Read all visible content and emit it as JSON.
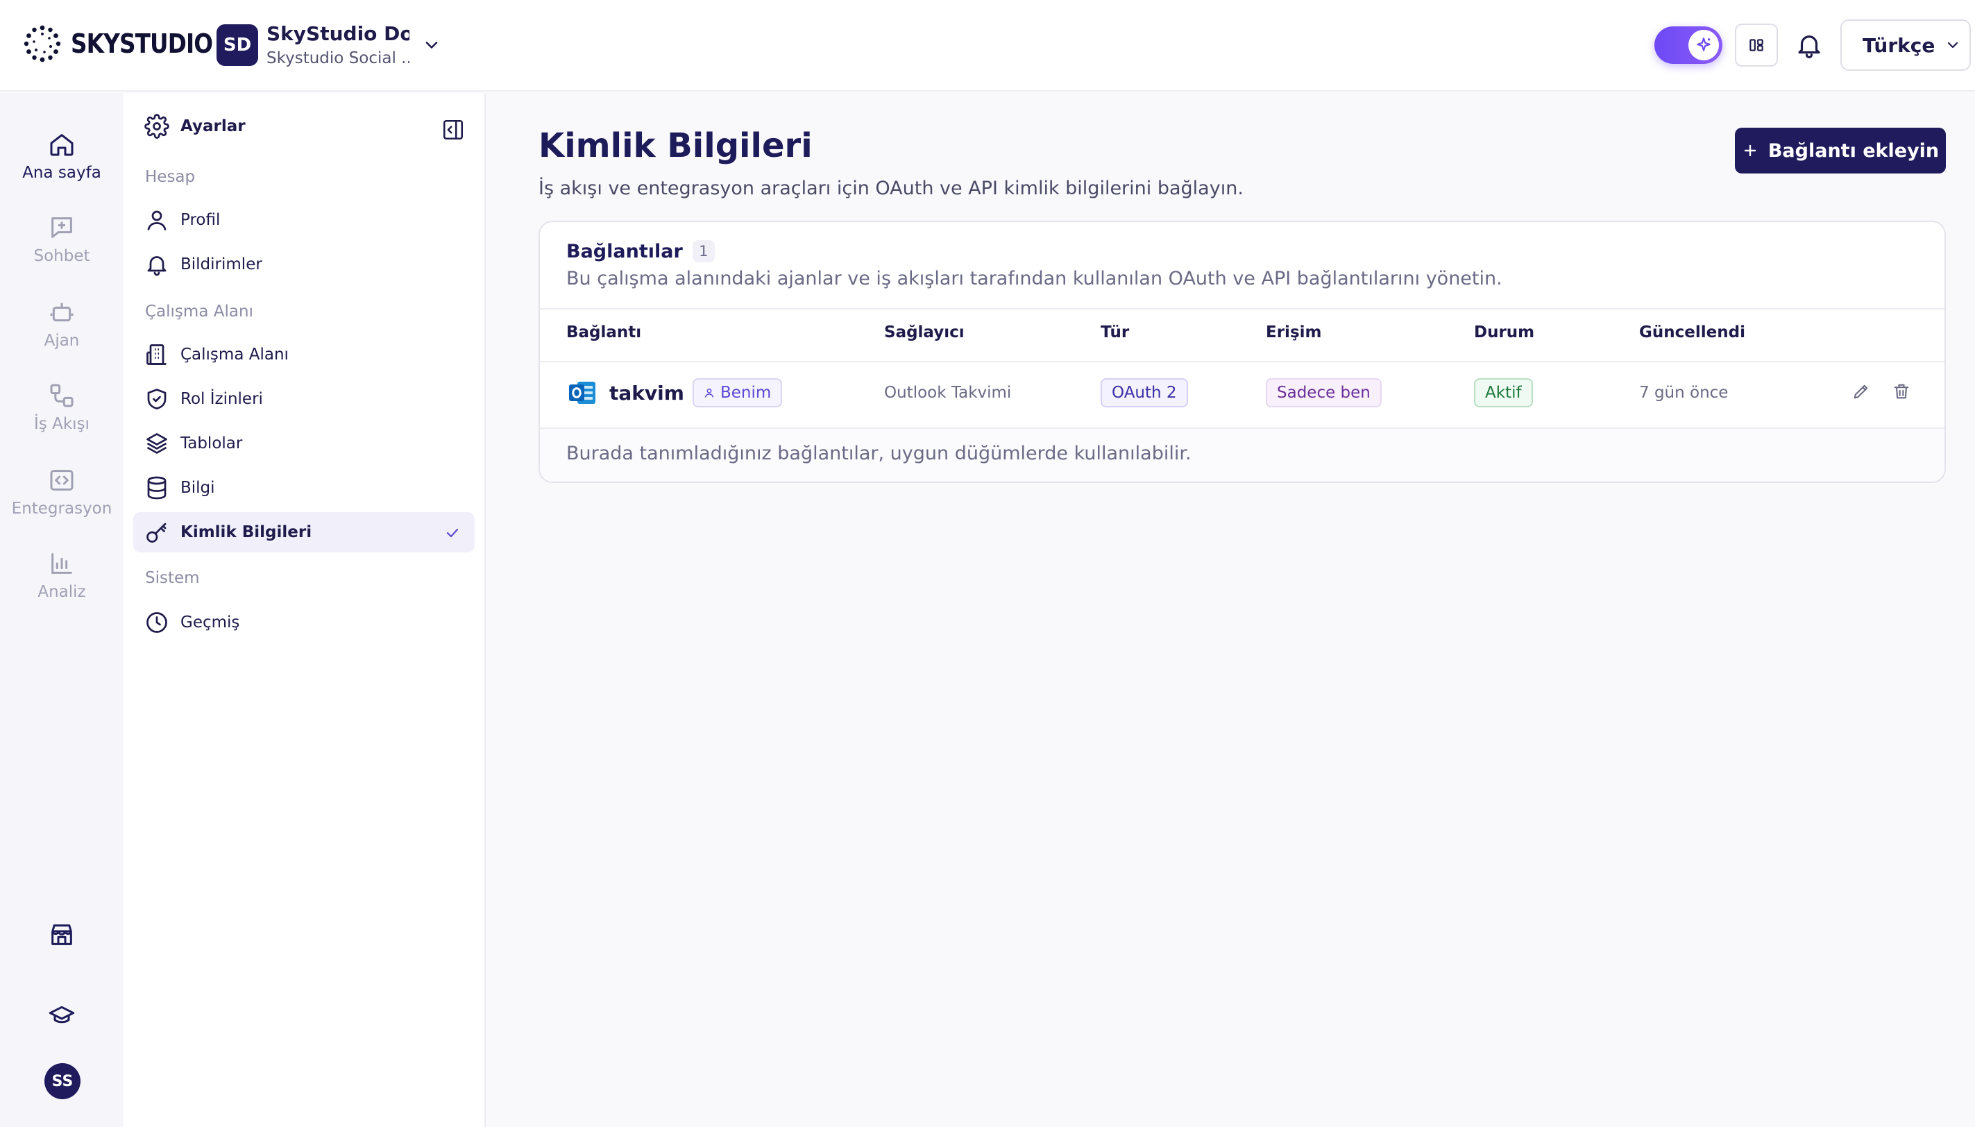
{
  "header": {
    "brand": "SKYSTUDIO",
    "workspace": {
      "initials": "SD",
      "name": "SkyStudio Do...",
      "subtitle": "Skystudio Social ..."
    },
    "language": "Türkçe"
  },
  "rail": {
    "items": [
      {
        "label": "Ana sayfa",
        "icon": "home-icon"
      },
      {
        "label": "Sohbet",
        "icon": "chat-icon"
      },
      {
        "label": "Ajan",
        "icon": "robot-icon"
      },
      {
        "label": "İş Akışı",
        "icon": "workflow-icon"
      },
      {
        "label": "Entegrasyon",
        "icon": "code-icon"
      },
      {
        "label": "Analiz",
        "icon": "chart-icon"
      }
    ],
    "avatar": "SS"
  },
  "settings": {
    "title": "Ayarlar",
    "sections": {
      "account": "Hesap",
      "workspace": "Çalışma Alanı",
      "system": "Sistem"
    },
    "items": [
      {
        "label": "Profil",
        "icon": "user-icon"
      },
      {
        "label": "Bildirimler",
        "icon": "bell-icon"
      },
      {
        "label": "Çalışma Alanı",
        "icon": "building-icon"
      },
      {
        "label": "Rol İzinleri",
        "icon": "shield-check-icon"
      },
      {
        "label": "Tablolar",
        "icon": "layers-icon"
      },
      {
        "label": "Bilgi",
        "icon": "database-icon"
      },
      {
        "label": "Kimlik Bilgileri",
        "icon": "key-icon"
      },
      {
        "label": "Geçmiş",
        "icon": "clock-icon"
      }
    ]
  },
  "main": {
    "title": "Kimlik Bilgileri",
    "subtitle": "İş akışı ve entegrasyon araçları için OAuth ve API kimlik bilgilerini bağlayın.",
    "add_button": "Bağlantı ekleyin",
    "card": {
      "title": "Bağlantılar",
      "count": "1",
      "subtitle": "Bu çalışma alanındaki ajanlar ve iş akışları tarafından kullanılan OAuth ve API bağlantılarını yönetin.",
      "columns": [
        "Bağlantı",
        "Sağlayıcı",
        "Tür",
        "Erişim",
        "Durum",
        "Güncellendi"
      ],
      "rows": [
        {
          "name": "takvim",
          "owner": "Benim",
          "provider": "Outlook Takvimi",
          "type": "OAuth 2",
          "access": "Sadece ben",
          "status": "Aktif",
          "updated": "7 gün önce"
        }
      ],
      "footer": "Burada tanımladığınız bağlantılar, uygun düğümlerde kullanılabilir."
    }
  },
  "colors": {
    "brand": "#1f1b5c",
    "accent": "#6d49f5",
    "status_active": "#1f7a3f"
  }
}
